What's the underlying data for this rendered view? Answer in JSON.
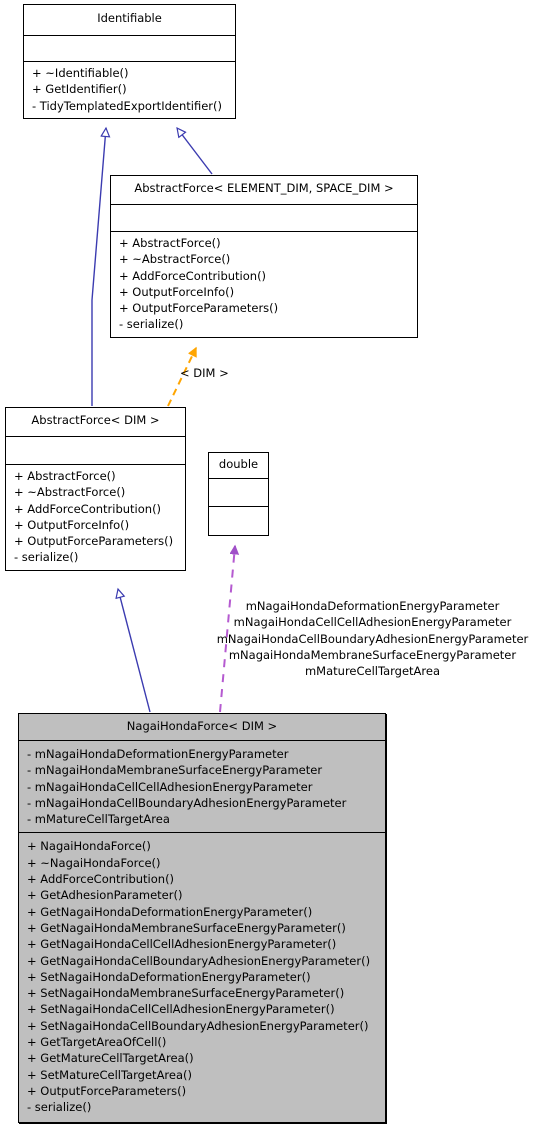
{
  "diagram": {
    "type": "uml-class-inheritance",
    "title": "NagaiHondaForce class inheritance diagram"
  },
  "classes": [
    {
      "id": "identifiable",
      "name": "Identifiable",
      "attributes": [],
      "operations": [
        "+ ~Identifiable()",
        "+ GetIdentifier()",
        "- TidyTemplatedExportIdentifier()"
      ],
      "highlighted": false
    },
    {
      "id": "abstract-force-template",
      "name": "AbstractForce< ELEMENT_DIM, SPACE_DIM >",
      "attributes": [],
      "operations": [
        "+ AbstractForce()",
        "+ ~AbstractForce()",
        "+ AddForceContribution()",
        "+ OutputForceInfo()",
        "+ OutputForceParameters()",
        "- serialize()"
      ],
      "highlighted": false
    },
    {
      "id": "abstract-force-dim",
      "name": "AbstractForce< DIM >",
      "attributes": [],
      "operations": [
        "+ AbstractForce()",
        "+ ~AbstractForce()",
        "+ AddForceContribution()",
        "+ OutputForceInfo()",
        "+ OutputForceParameters()",
        "- serialize()"
      ],
      "highlighted": false
    },
    {
      "id": "double",
      "name": "double",
      "attributes": [],
      "operations": [],
      "highlighted": false
    },
    {
      "id": "nagai-honda-force",
      "name": "NagaiHondaForce< DIM >",
      "attributes": [
        "- mNagaiHondaDeformationEnergyParameter",
        "- mNagaiHondaMembraneSurfaceEnergyParameter",
        "- mNagaiHondaCellCellAdhesionEnergyParameter",
        "- mNagaiHondaCellBoundaryAdhesionEnergyParameter",
        "- mMatureCellTargetArea"
      ],
      "operations": [
        "+ NagaiHondaForce()",
        "+ ~NagaiHondaForce()",
        "+ AddForceContribution()",
        "+ GetAdhesionParameter()",
        "+ GetNagaiHondaDeformationEnergyParameter()",
        "+ GetNagaiHondaMembraneSurfaceEnergyParameter()",
        "+ GetNagaiHondaCellCellAdhesionEnergyParameter()",
        "+ GetNagaiHondaCellBoundaryAdhesionEnergyParameter()",
        "+ SetNagaiHondaDeformationEnergyParameter()",
        "+ SetNagaiHondaMembraneSurfaceEnergyParameter()",
        "+ SetNagaiHondaCellCellAdhesionEnergyParameter()",
        "+ SetNagaiHondaCellBoundaryAdhesionEnergyParameter()",
        "+ GetTargetAreaOfCell()",
        "+ GetMatureCellTargetArea()",
        "+ SetMatureCellTargetArea()",
        "+ OutputForceParameters()",
        "- serialize()"
      ],
      "highlighted": true
    }
  ],
  "edges": {
    "template_binding_label": "< DIM >",
    "usage_labels": [
      "mNagaiHondaDeformationEnergyParameter",
      "mNagaiHondaCellCellAdhesionEnergyParameter",
      "mNagaiHondaCellBoundaryAdhesionEnergyParameter",
      "mNagaiHondaMembraneSurfaceEnergyParameter",
      "mMatureCellTargetArea"
    ]
  },
  "colors": {
    "inheritance_edge": "#3b3bb0",
    "template_edge": "#ffa500",
    "usage_edge": "#b55ad0",
    "highlight_fill": "#bfbfbf",
    "box_border": "#000000",
    "background": "#ffffff"
  }
}
